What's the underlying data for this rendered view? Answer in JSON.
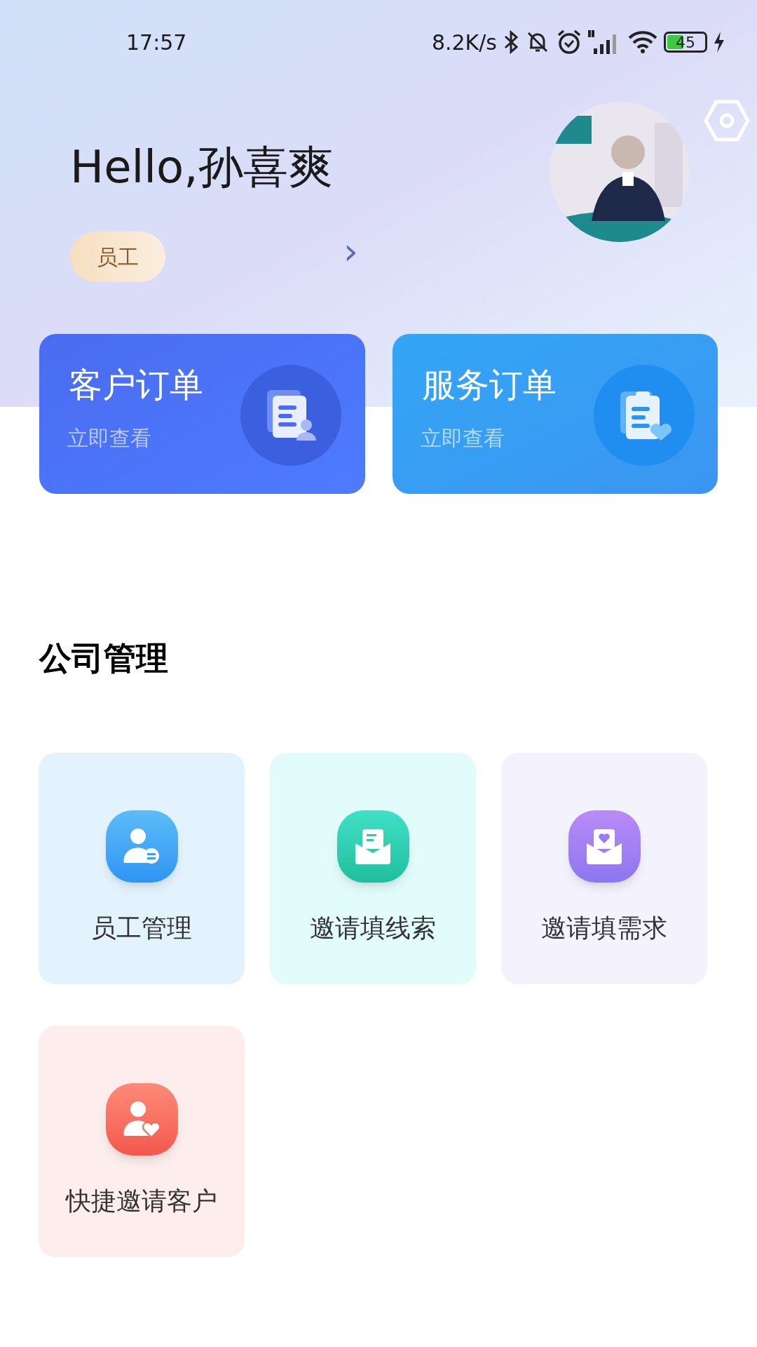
{
  "status_bar": {
    "time": "17:57",
    "net_speed": "8.2K/s",
    "battery": "45"
  },
  "header": {
    "greeting": "Hello,孙喜爽",
    "role_badge": "员工",
    "chevron": "›"
  },
  "order_cards": [
    {
      "kind": "customer",
      "title": "客户订单",
      "subtitle": "立即查看"
    },
    {
      "kind": "service",
      "title": "服务订单",
      "subtitle": "立即查看"
    }
  ],
  "section": {
    "title": "公司管理"
  },
  "tiles": [
    {
      "kind": "staff",
      "label": "员工管理"
    },
    {
      "kind": "lead",
      "label": "邀请填线索"
    },
    {
      "kind": "demand",
      "label": "邀请填需求"
    },
    {
      "kind": "invite",
      "label": "快捷邀请客户"
    }
  ]
}
